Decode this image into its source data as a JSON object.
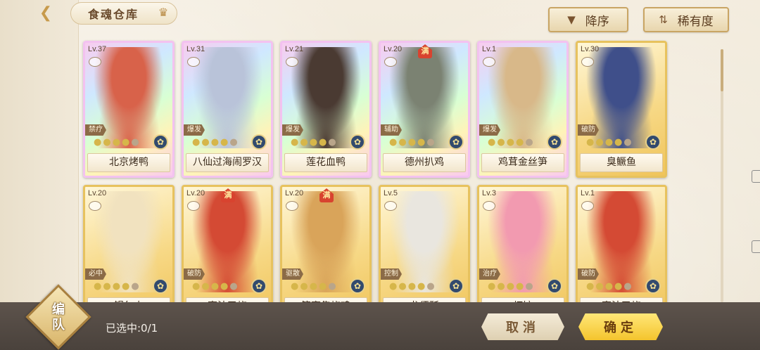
{
  "header": {
    "title": "食魂仓库",
    "sort_order_label": "降序",
    "sort_key_label": "稀有度"
  },
  "cards": [
    {
      "level": "Lv.37",
      "role": "禁疗",
      "name": "北京烤鸭",
      "full": "",
      "frame": "rainbow",
      "art_color": "#d8624a",
      "stars": 4
    },
    {
      "level": "Lv.31",
      "role": "爆发",
      "name": "八仙过海闹罗汉",
      "full": "",
      "frame": "rainbow",
      "art_color": "#b9c3d9",
      "stars": 4
    },
    {
      "level": "Lv.21",
      "role": "爆发",
      "name": "莲花血鸭",
      "full": "",
      "frame": "rainbow",
      "art_color": "#4a3a32",
      "stars": 4
    },
    {
      "level": "Lv.20",
      "role": "辅助",
      "name": "德州扒鸡",
      "full": "满",
      "frame": "rainbow",
      "art_color": "#7b8272",
      "stars": 4
    },
    {
      "level": "Lv.1",
      "role": "爆发",
      "name": "鸡茸金丝笋",
      "full": "",
      "frame": "rainbow",
      "art_color": "#d8b889",
      "stars": 4
    },
    {
      "level": "Lv.30",
      "role": "破防",
      "name": "臭鳜鱼",
      "full": "",
      "frame": "gold",
      "art_color": "#3f4f8a",
      "stars": 4
    },
    {
      "level": "Lv.20",
      "role": "必中",
      "name": "锅包肉",
      "full": "",
      "frame": "gold",
      "art_color": "#f1e2bf",
      "stars": 4
    },
    {
      "level": "Lv.20",
      "role": "破防",
      "name": "蜜汁叉烧",
      "full": "满",
      "frame": "gold",
      "art_color": "#d44a34",
      "stars": 4
    },
    {
      "level": "Lv.20",
      "role": "驱散",
      "name": "符离集烧鸡",
      "full": "满",
      "frame": "gold",
      "art_color": "#d9a45a",
      "stars": 4
    },
    {
      "level": "Lv.5",
      "role": "控制",
      "name": "龙须酥",
      "full": "",
      "frame": "gold",
      "art_color": "#e9e6df",
      "stars": 4
    },
    {
      "level": "Lv.3",
      "role": "治疗",
      "name": "虾饺",
      "full": "",
      "frame": "gold",
      "art_color": "#f29ab0",
      "stars": 4
    },
    {
      "level": "Lv.1",
      "role": "破防",
      "name": "蜜汁叉烧",
      "full": "",
      "frame": "gold",
      "art_color": "#d44a34",
      "stars": 4
    }
  ],
  "footer": {
    "team_label_1": "编",
    "team_label_2": "队",
    "selected_text": "已选中:0/1",
    "cancel_label": "取消",
    "confirm_label": "确定"
  }
}
